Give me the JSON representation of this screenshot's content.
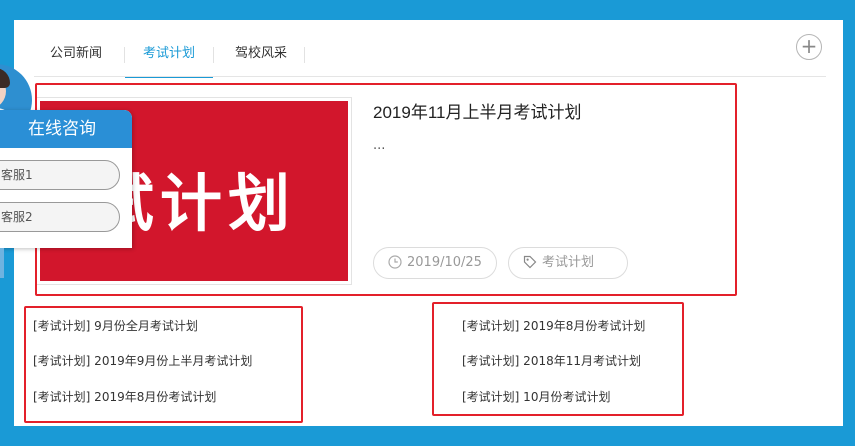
{
  "tabs": [
    {
      "label": "公司新闻"
    },
    {
      "label": "考试计划"
    },
    {
      "label": "驾校风采"
    }
  ],
  "active_tab": "考试计划",
  "more_label": "+",
  "featured": {
    "image_text": "试计划",
    "title": "2019年11月上半月考试计划",
    "summary": "...",
    "date": "2019/10/25",
    "tag": "考试计划"
  },
  "links_left": [
    {
      "text": "[考试计划] 9月份全月考试计划"
    },
    {
      "text": "[考试计划] 2019年9月份上半月考试计划"
    },
    {
      "text": "[考试计划] 2019年8月份考试计划"
    }
  ],
  "links_right": [
    {
      "text": "[考试计划] 2019年8月份考试计划"
    },
    {
      "text": "[考试计划] 2018年11月考试计划"
    },
    {
      "text": "[考试计划] 10月份考试计划"
    }
  ],
  "consult": {
    "title": "在线咨询",
    "buttons": [
      {
        "label": "客服1"
      },
      {
        "label": "客服2"
      }
    ]
  },
  "colors": {
    "accent": "#1a9ad6",
    "highlight_box": "#e3202a",
    "thumb_bg": "#d2162c"
  }
}
